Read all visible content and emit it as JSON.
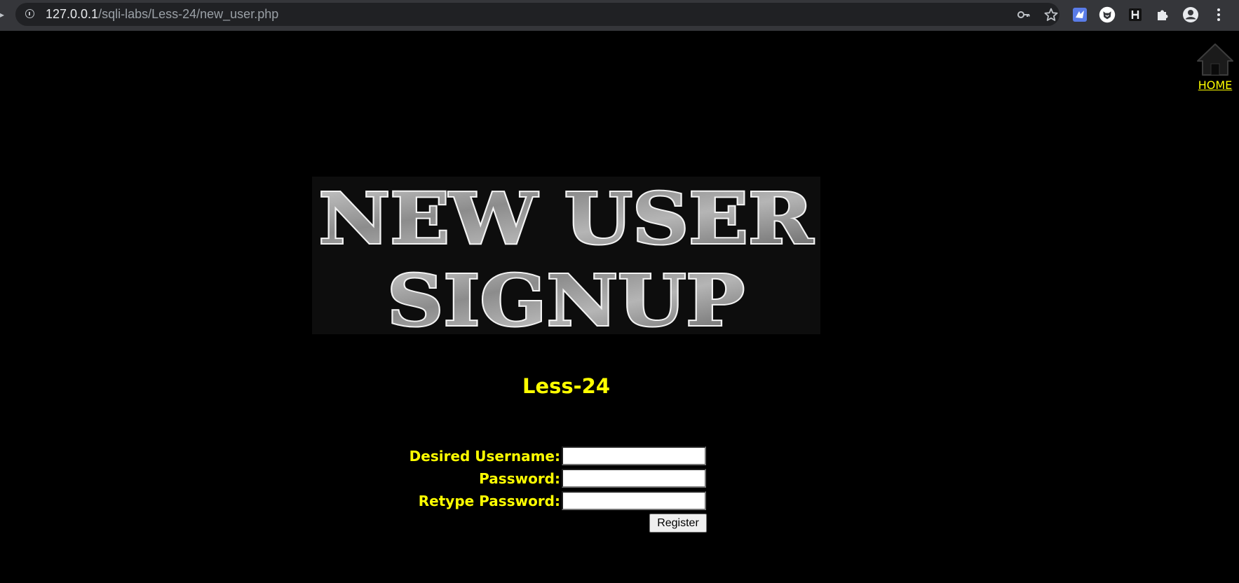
{
  "browser": {
    "url_host": "127.0.0.1",
    "url_path": "/sqli-labs/Less-24/new_user.php",
    "edge_glyph": "▸",
    "omnibox_icons": [
      "info-icon",
      "key-icon",
      "star-icon"
    ],
    "toolbar_icons": [
      "extension-icon",
      "fox-extension-icon",
      "h-extension-icon",
      "puzzle-icon",
      "profile-icon",
      "menu-icon"
    ]
  },
  "page": {
    "home_label": "HOME",
    "banner_line1": "NEW USER",
    "banner_line2": "SIGNUP",
    "lesson_title": "Less-24",
    "accent_color": "#ffff00",
    "background_color": "#000000"
  },
  "form": {
    "username_label": "Desired Username:",
    "username_value": "",
    "password_label": "Password:",
    "password_value": "",
    "retype_label": "Retype Password:",
    "retype_value": "",
    "register_label": "Register"
  }
}
